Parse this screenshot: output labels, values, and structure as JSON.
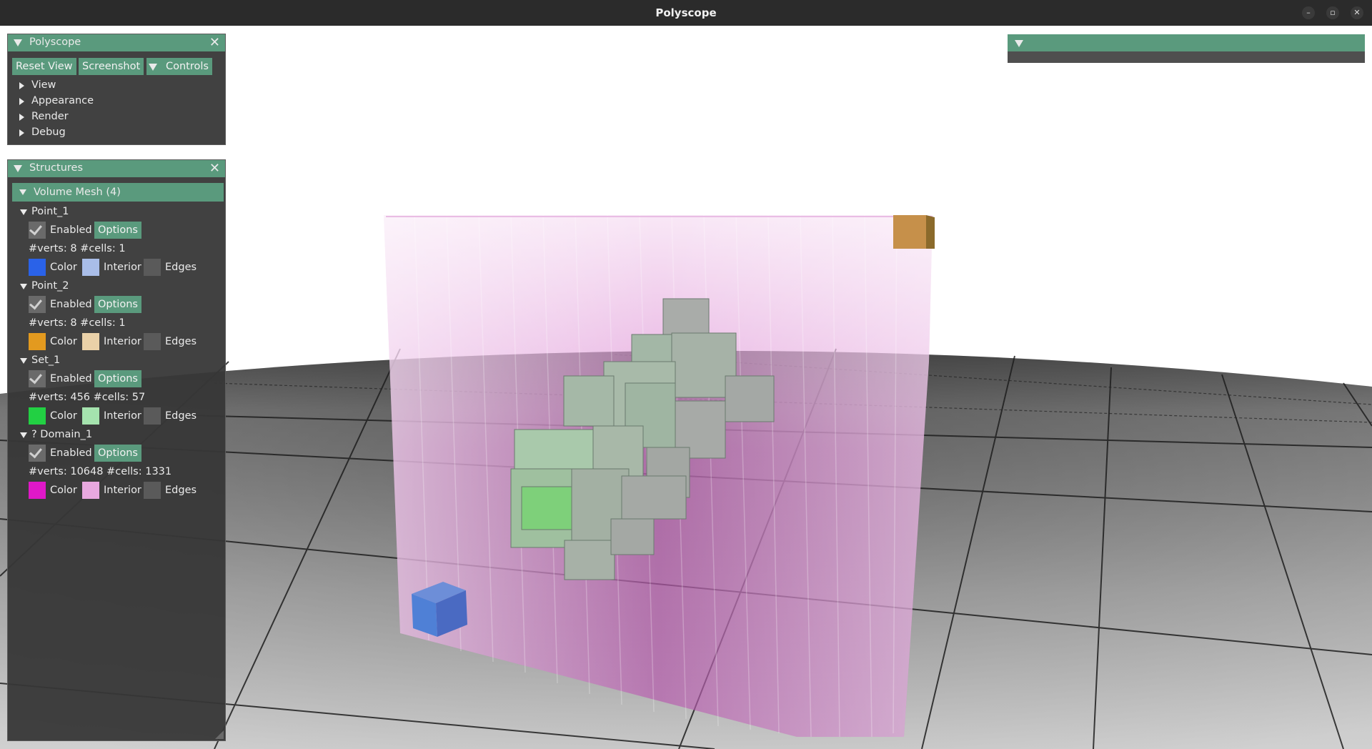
{
  "window": {
    "title": "Polyscope",
    "minimize": "–",
    "restore": "▫",
    "close": "✕"
  },
  "polyscope_panel": {
    "title": "Polyscope",
    "close": "✕",
    "buttons": {
      "reset_view": "Reset View",
      "screenshot": "Screenshot",
      "controls": "Controls"
    },
    "sections": [
      "View",
      "Appearance",
      "Render",
      "Debug"
    ]
  },
  "structures_panel": {
    "title": "Structures",
    "close": "✕",
    "group": "Volume Mesh (4)",
    "labels": {
      "enabled": "Enabled",
      "options": "Options",
      "color": "Color",
      "interior": "Interior",
      "edges": "Edges"
    },
    "items": [
      {
        "name": "Point_1",
        "stats": "#verts: 8  #cells: 1",
        "enabled": true,
        "color": "#2a62e8",
        "interior": "#a9bde8",
        "edges": "#5a5a5a"
      },
      {
        "name": "Point_2",
        "stats": "#verts: 8  #cells: 1",
        "enabled": true,
        "color": "#e39a1f",
        "interior": "#ead1a8",
        "edges": "#5a5a5a"
      },
      {
        "name": "Set_1",
        "stats": "#verts: 456  #cells: 57",
        "enabled": true,
        "color": "#22d043",
        "interior": "#a5e3ae",
        "edges": "#5a5a5a"
      },
      {
        "name": "? Domain_1",
        "stats": "#verts: 10648  #cells: 1331",
        "enabled": true,
        "color": "#e018c8",
        "interior": "#e8a8df",
        "edges": "#5a5a5a"
      }
    ]
  },
  "colors": {
    "accent": "#5a9a7d",
    "panel_bg": "#373737",
    "titlebar": "#2b2b2b"
  }
}
